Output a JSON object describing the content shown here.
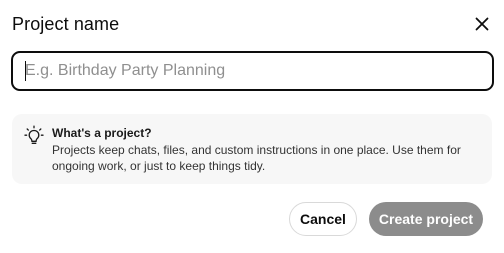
{
  "dialog": {
    "title": "Project name",
    "close_icon": "close-icon"
  },
  "input": {
    "value": "",
    "placeholder": "E.g. Birthday Party Planning"
  },
  "info": {
    "icon": "lightbulb-icon",
    "heading": "What's a project?",
    "text": "Projects keep chats, files, and custom instructions in one place. Use them for ongoing work, or just to keep things tidy."
  },
  "buttons": {
    "cancel": "Cancel",
    "create": "Create project"
  },
  "colors": {
    "primary_disabled": "#8c8c8c",
    "info_bg": "#f7f7f7",
    "input_border": "#0d0d0d"
  }
}
